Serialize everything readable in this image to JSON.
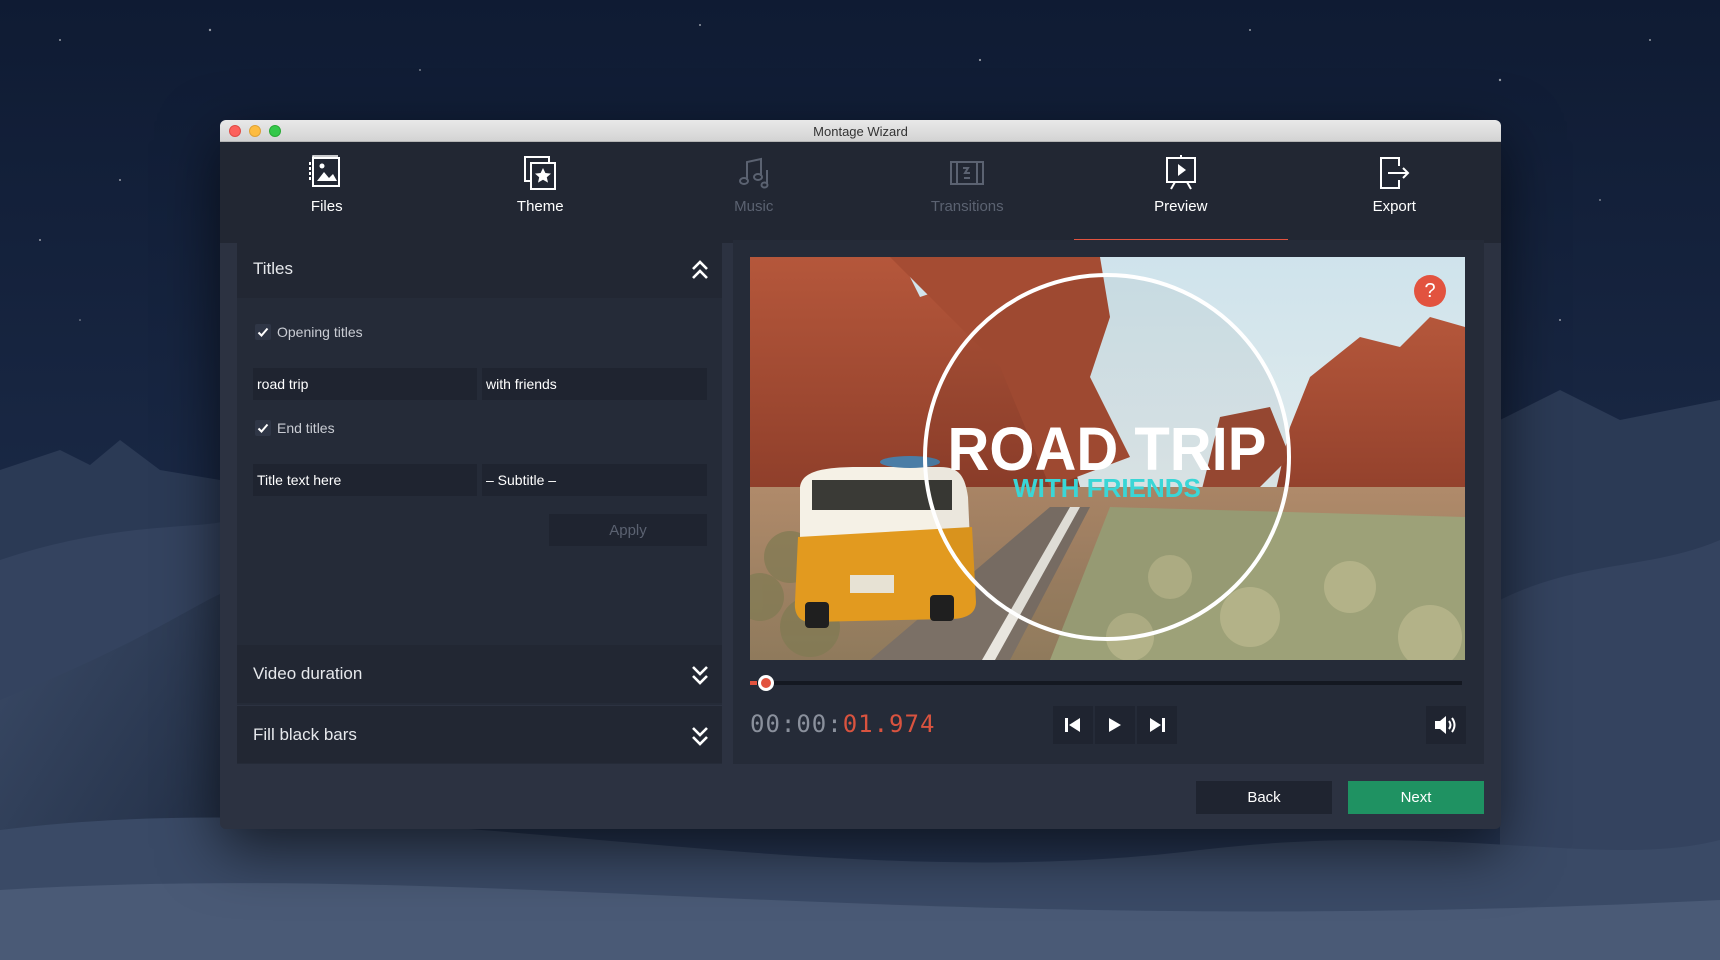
{
  "window": {
    "title": "Montage Wizard"
  },
  "nav": {
    "tabs": [
      {
        "label": "Files",
        "icon": "files-icon",
        "state": "enabled"
      },
      {
        "label": "Theme",
        "icon": "theme-icon",
        "state": "enabled"
      },
      {
        "label": "Music",
        "icon": "music-icon",
        "state": "disabled"
      },
      {
        "label": "Transitions",
        "icon": "transitions-icon",
        "state": "disabled"
      },
      {
        "label": "Preview",
        "icon": "preview-icon",
        "state": "active"
      },
      {
        "label": "Export",
        "icon": "export-icon",
        "state": "enabled"
      }
    ]
  },
  "titles_panel": {
    "header": "Titles",
    "opening": {
      "label": "Opening titles",
      "checked": true,
      "title_value": "road trip",
      "subtitle_value": "with friends"
    },
    "ending": {
      "label": "End titles",
      "checked": true,
      "title_placeholder": "Title text here",
      "subtitle_placeholder": "– Subtitle –"
    },
    "apply_label": "Apply"
  },
  "sections": {
    "video_duration": "Video duration",
    "fill_black_bars": "Fill black bars"
  },
  "preview": {
    "overlay_title": "ROAD TRIP",
    "overlay_subtitle": "WITH FRIENDS",
    "help_label": "?",
    "timecode_dim": "00:00:",
    "timecode_live": "01.974",
    "progress_fraction": 0.01
  },
  "footer": {
    "back_label": "Back",
    "next_label": "Next"
  },
  "colors": {
    "accent": "#e2533f",
    "next_button": "#1f9262",
    "overlay_subtitle": "#3ad6d6"
  }
}
